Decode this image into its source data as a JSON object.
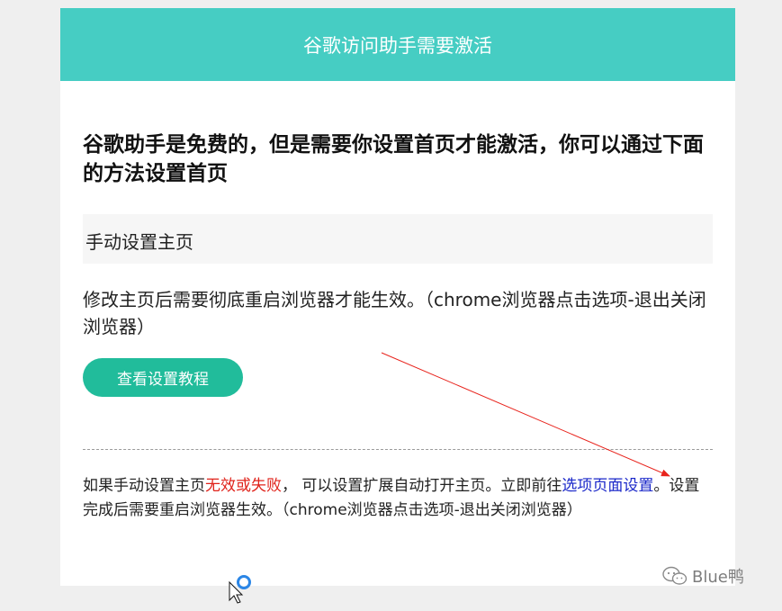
{
  "header": {
    "title": "谷歌访问助手需要激活"
  },
  "headline": "谷歌助手是免费的，但是需要你设置首页才能激活，你可以通过下面的方法设置首页",
  "manual_section": {
    "title": "手动设置主页",
    "note": "修改主页后需要彻底重启浏览器才能生效。（chrome浏览器点击选项-退出关闭浏览器）",
    "button_label": "查看设置教程"
  },
  "fallback": {
    "text_before": "如果手动设置主页",
    "highlight": "无效或失败",
    "text_mid": "，  可以设置扩展自动打开主页。立即前往",
    "link": "选项页面设置",
    "text_after": "。设置完成后需要重启浏览器生效。（chrome浏览器点击选项-退出关闭浏览器）"
  },
  "watermark": {
    "text": "Blue鸭"
  },
  "colors": {
    "header_bg": "#46cdc3",
    "button_bg": "#21bc9b",
    "highlight": "#e0231b",
    "link": "#1a27c9",
    "arrow": "#e8231c"
  },
  "icons": {
    "cursor": "arrow-cursor-icon",
    "loading": "loading-spinner-icon",
    "watermark": "wechat-icon"
  }
}
